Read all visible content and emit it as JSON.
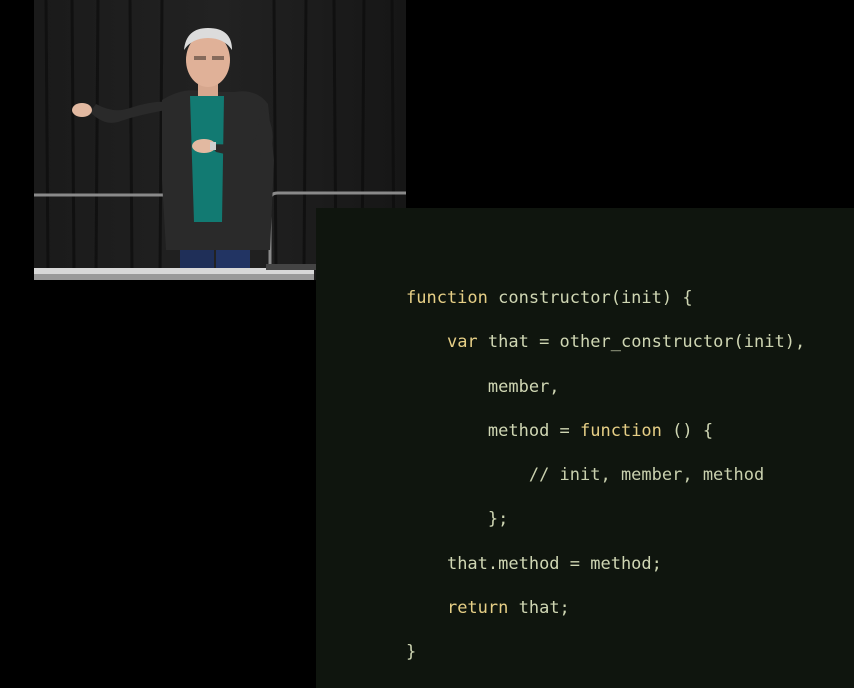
{
  "slide": {
    "background": "#0f150e",
    "text_color": "#cfd6b3",
    "keyword_color": "#e6cf86",
    "code_lines": [
      {
        "indent": 0,
        "parts": [
          {
            "t": "function",
            "c": "kw"
          },
          {
            "t": " constructor(init) {",
            "c": ""
          }
        ]
      },
      {
        "indent": 1,
        "parts": [
          {
            "t": "var",
            "c": "kw"
          },
          {
            "t": " that = other_constructor(init),",
            "c": ""
          }
        ]
      },
      {
        "indent": 2,
        "parts": [
          {
            "t": "member,",
            "c": ""
          }
        ]
      },
      {
        "indent": 2,
        "parts": [
          {
            "t": "method = ",
            "c": ""
          },
          {
            "t": "function",
            "c": "kw"
          },
          {
            "t": " () {",
            "c": ""
          }
        ]
      },
      {
        "indent": 3,
        "parts": [
          {
            "t": "// init, member, method",
            "c": "cm"
          }
        ]
      },
      {
        "indent": 2,
        "parts": [
          {
            "t": "};",
            "c": ""
          }
        ]
      },
      {
        "indent": 1,
        "parts": [
          {
            "t": "that.method = method;",
            "c": ""
          }
        ]
      },
      {
        "indent": 1,
        "parts": [
          {
            "t": "return",
            "c": "kw"
          },
          {
            "t": " that;",
            "c": ""
          }
        ]
      },
      {
        "indent": 0,
        "parts": [
          {
            "t": "}",
            "c": ""
          }
        ]
      }
    ]
  }
}
